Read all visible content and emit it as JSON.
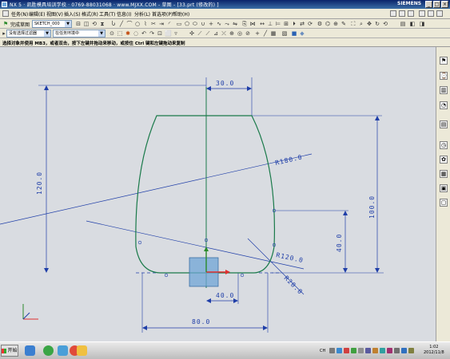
{
  "window": {
    "title": "NX 5 · 凯胜模具培训学校 · 0769-88031068 · www.MJXX.COM - 草图 - [33.prt (修改的) ]",
    "brand": "SIEMENS",
    "controls": [
      "_",
      "□",
      "×"
    ]
  },
  "menu": {
    "items": [
      "任务(N)",
      "编辑(E)",
      "视图(V)",
      "插入(S)",
      "格式(R)",
      "工具(T)",
      "信息(I)",
      "分析(L)",
      "首选项(P)",
      "帮助(H)"
    ]
  },
  "toolbar1": {
    "finish_sketch": "完成草图",
    "sketch_name": "SKETCH_000"
  },
  "toolbar2": {
    "selection_filter": "没有选择过滤器",
    "scope": "在任务环境中"
  },
  "cue_line": "选择对象并使用 MB3，或者双击，按下左键并拖动来移动，或按住 Ctrl 键和左键拖动来复制",
  "dimensions": {
    "top_width": "30.0",
    "overall_height": "120.0",
    "arc_large": "R180.0",
    "right_height": "100.0",
    "right_lower": "40.0",
    "arc_mid": "R120.0",
    "fillet": "R20.0",
    "half_base": "40.0",
    "base_width": "80.0"
  },
  "taskbar": {
    "start_label": "开始",
    "ime": "CH",
    "clock_time": "1:02",
    "clock_date": "2012/11/8"
  },
  "colors": {
    "canvas": "#d9dce1",
    "sketch_curve": "#1a7a4a",
    "dimension": "#1f3ea8",
    "x_axis": "#e03030",
    "y_axis": "#2a8a2a",
    "titlebar": "#0a246a"
  },
  "icons": {
    "resource_bar": [
      "roles-icon",
      "history-icon",
      "assembly-navigator-icon",
      "part-navigator-icon",
      "reuse-library-icon",
      "web-browser-icon",
      "history-palette-icon",
      "system-materials-icon",
      "process-studio-icon",
      "roles-palette-icon"
    ]
  }
}
